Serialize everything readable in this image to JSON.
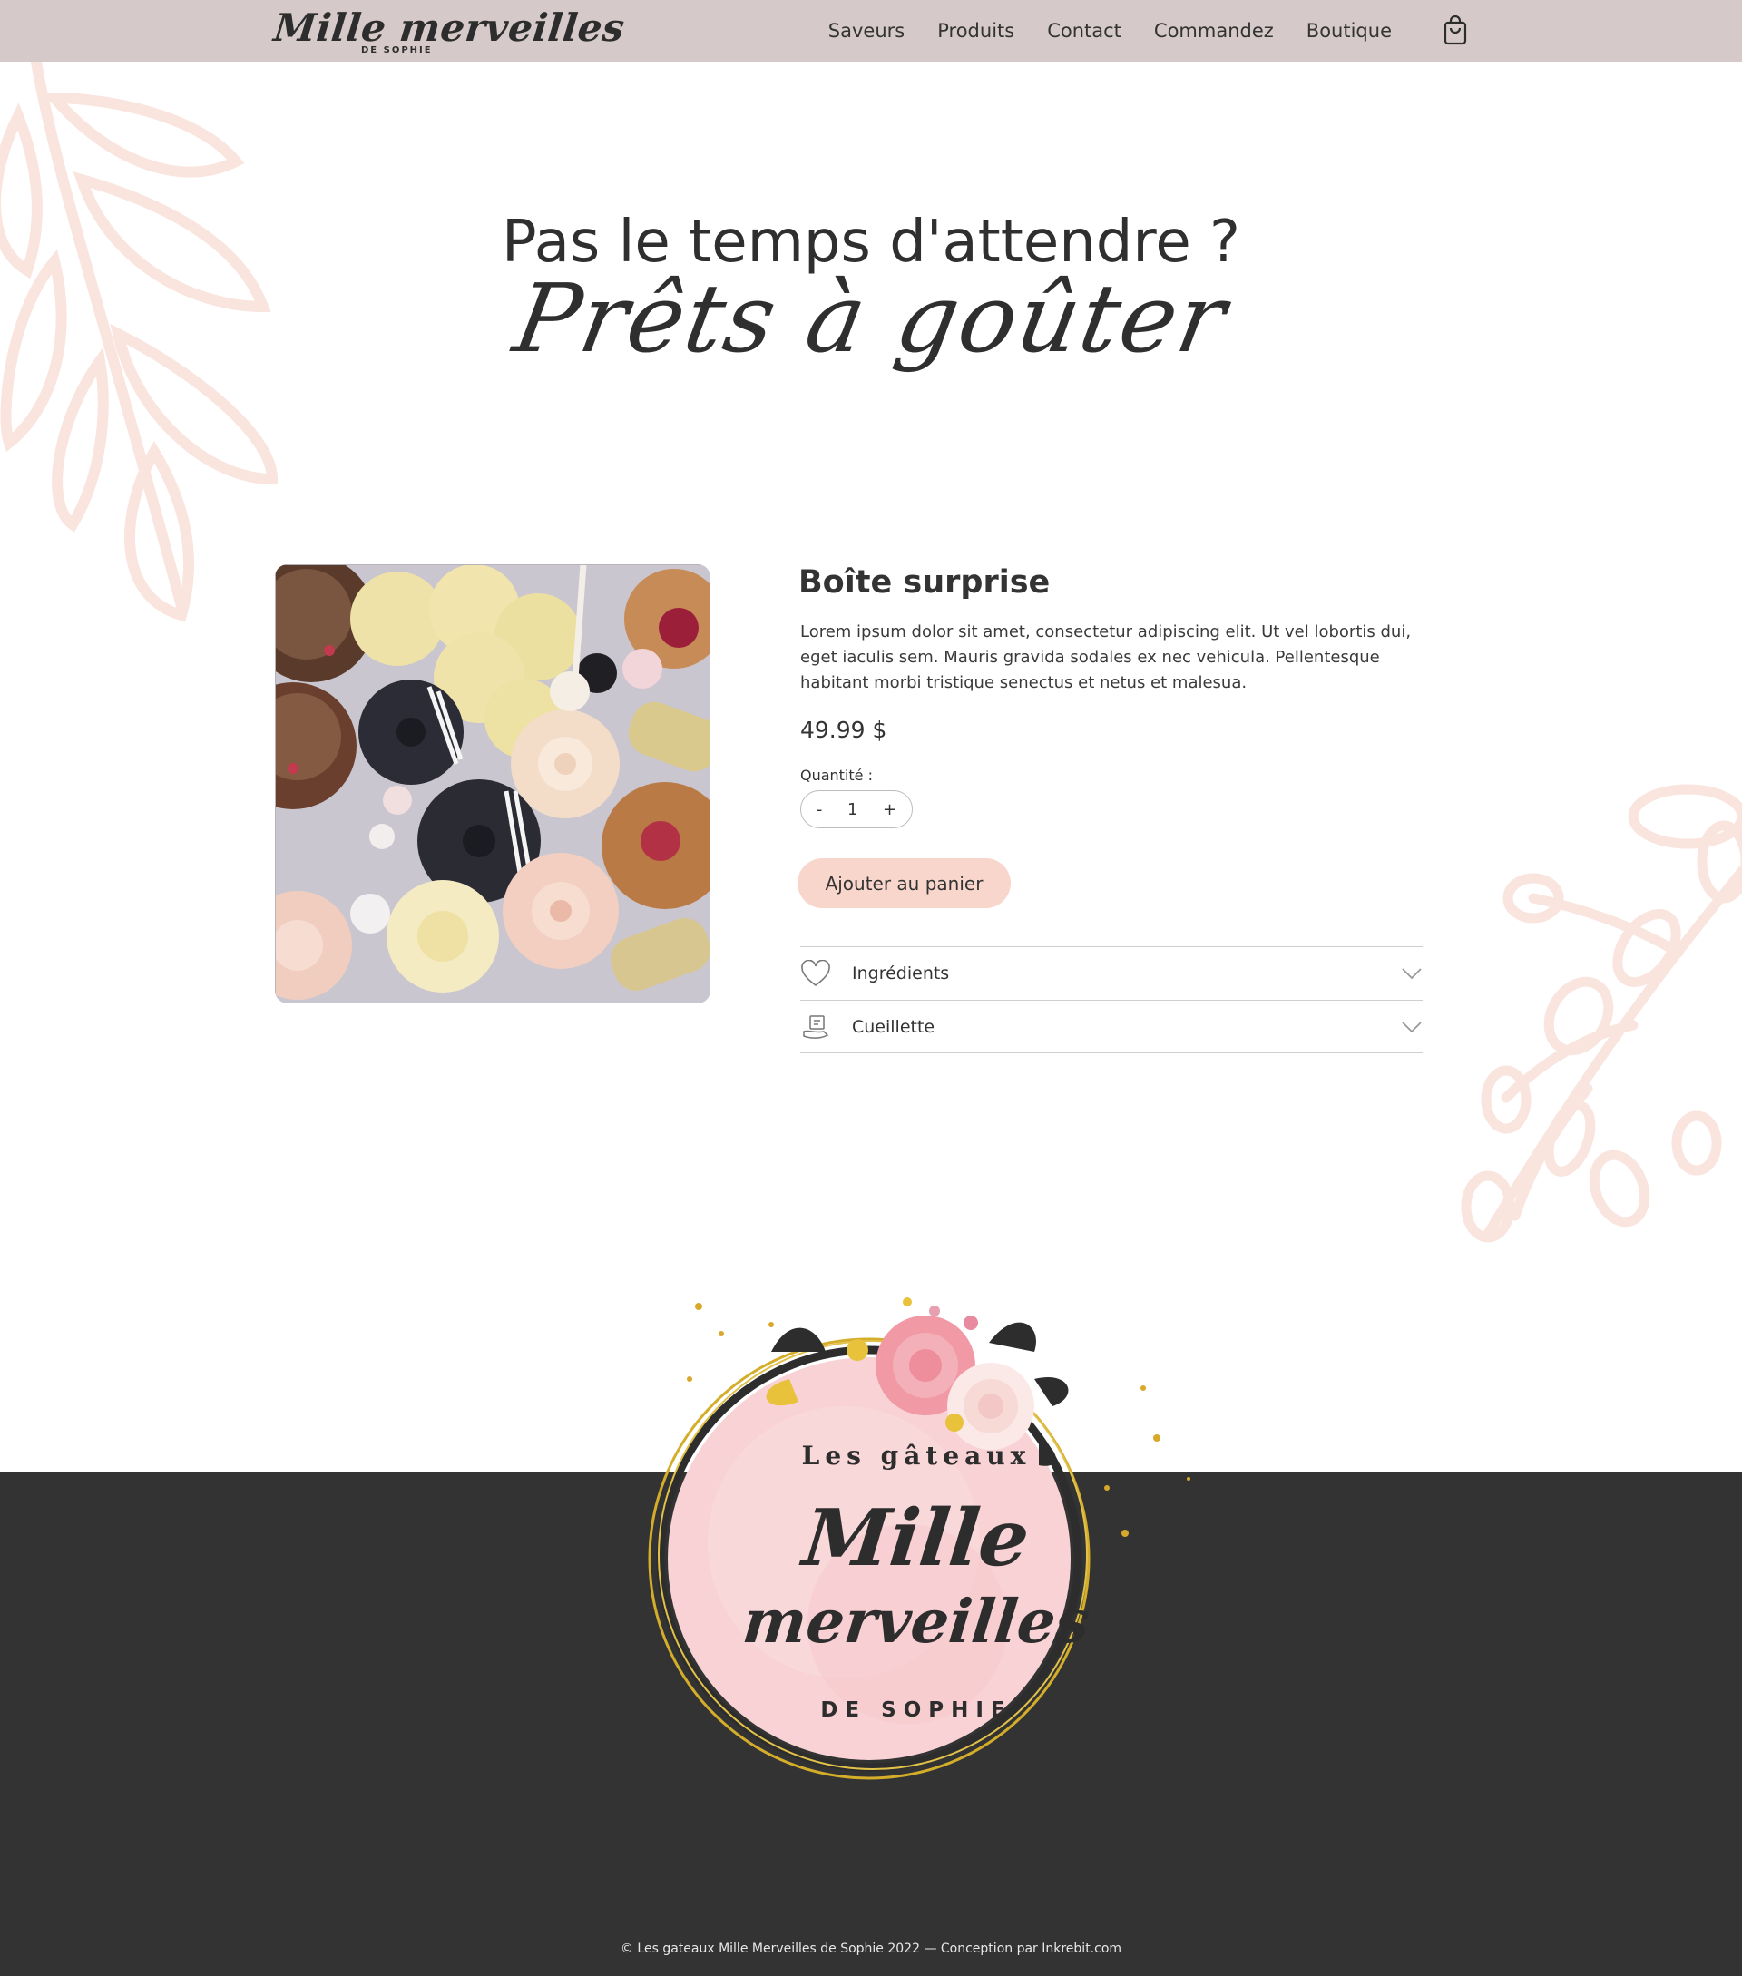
{
  "header": {
    "logo_main": "Mille merveilles",
    "logo_sub": "DE SOPHIE",
    "nav": [
      "Saveurs",
      "Produits",
      "Contact",
      "Commandez",
      "Boutique"
    ],
    "cart_icon": "shopping-bag-icon"
  },
  "hero": {
    "title": "Pas le temps d'attendre ?",
    "script": "Prêts à goûter"
  },
  "product": {
    "title": "Boîte surprise",
    "description": "Lorem ipsum dolor sit amet, consectetur adipiscing elit. Ut vel lobortis dui, eget iaculis sem. Mauris gravida sodales ex nec vehicula. Pellentesque habitant morbi tristique senectus et netus et malesua.",
    "price": "49.99 $",
    "quantity_label": "Quantité :",
    "quantity": {
      "minus": "-",
      "value": "1",
      "plus": "+"
    },
    "add_to_cart": "Ajouter au panier",
    "accordion": [
      {
        "label": "Ingrédients",
        "icon": "heart-icon"
      },
      {
        "label": "Cueillette",
        "icon": "delivery-icon"
      }
    ]
  },
  "badge": {
    "top": "Les gâteaux",
    "line1": "Mille",
    "line2": "merveilles",
    "bottom": "DE SOPHIE"
  },
  "footer": {
    "copyright": "© Les gateaux Mille Merveilles de Sophie 2022 — Conception par Inkrebit.com"
  },
  "colors": {
    "header_bg": "#d6c9c9",
    "button_bg": "#f8d6cc",
    "footer_bg": "#333333",
    "decoration": "#f9e4de"
  }
}
